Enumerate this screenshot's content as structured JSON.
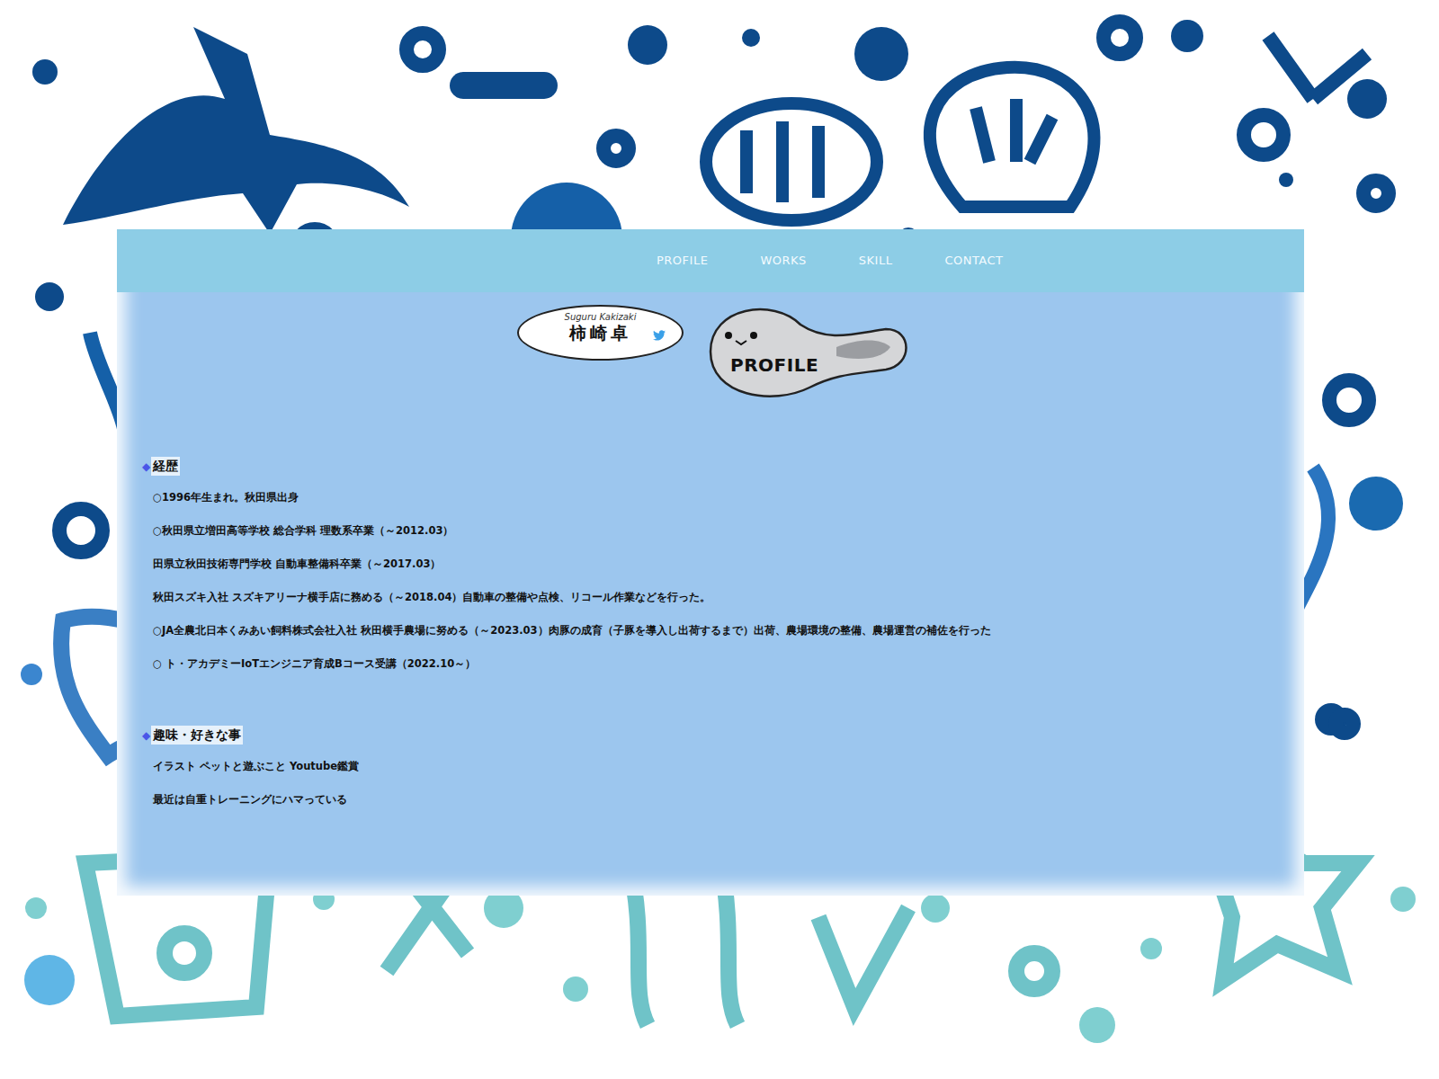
{
  "nav": [
    {
      "label": "PROFILE"
    },
    {
      "label": "WORKS"
    },
    {
      "label": "SKILL"
    },
    {
      "label": "CONTACT"
    }
  ],
  "logo": {
    "name_en": "Suguru Kakizaki",
    "name_ja": "柿崎卓",
    "badge": "PROFILE"
  },
  "sections": [
    {
      "marker": "◆",
      "title": "経歴",
      "items": [
        "○1996年生まれ。秋田県出身",
        "○秋田県立増田高等学校 総合学科 理数系卒業（～2012.03）",
        "田県立秋田技術専門学校 自動車整備科卒業（～2017.03）",
        "秋田スズキ入社 スズキアリーナ横手店に務める（～2018.04）自動車の整備や点検、リコール作業などを行った。",
        "○JA全農北日本くみあい飼料株式会社入社 秋田横手農場に努める（～2023.03）肉豚の成育（子豚を導入し出荷するまで）出荷、農場環境の整備、農場運営の補佐を行った",
        "○ ト・アカデミーIoTエンジニア育成Bコース受講（2022.10～）"
      ]
    },
    {
      "marker": "◆",
      "title": "趣味・好きな事",
      "items": [
        "イラスト ペットと遊ぶこと Youtube鑑賞",
        "最近は自重トレーニングにハマっている"
      ]
    }
  ]
}
